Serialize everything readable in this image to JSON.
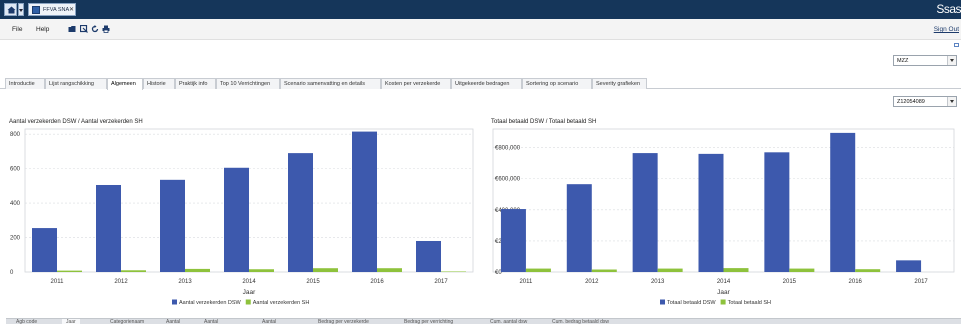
{
  "titlebar": {
    "document_tab_label": "FFVA SNA",
    "document_tab_close": "✕",
    "brand": "Ssas"
  },
  "menubar": {
    "file_label": "File",
    "help_label": "Help",
    "signout_label": "Sign Out"
  },
  "selectors": {
    "region_value": "MZZ",
    "provider_value": "Z12054089"
  },
  "tabs": [
    {
      "label": "Introductie",
      "active": false
    },
    {
      "label": "Lijst rangschikking",
      "active": false
    },
    {
      "label": "Algemeen",
      "active": true
    },
    {
      "label": "Historie",
      "active": false
    },
    {
      "label": "Praktijk info",
      "active": false
    },
    {
      "label": "Top 10 Verrichtingen",
      "active": false
    },
    {
      "label": "Scenario samenvatting en details",
      "active": false
    },
    {
      "label": "Kosten per verzekerde",
      "active": false
    },
    {
      "label": "Uitgekeerde bedragen",
      "active": false
    },
    {
      "label": "Sortering op scenario",
      "active": false
    },
    {
      "label": "Severity grafieken",
      "active": false
    }
  ],
  "colors": {
    "titlebar_bg": "#15365a",
    "series_primary": "#3d59ad",
    "series_secondary": "#8ec23c"
  },
  "chart_data": [
    {
      "type": "bar",
      "title": "Aantal verzekerden DSW / Aantal verzekerden SH",
      "xlabel": "Jaar",
      "ylabel": "",
      "categories": [
        "2011",
        "2012",
        "2013",
        "2014",
        "2015",
        "2016",
        "2017"
      ],
      "series": [
        {
          "name": "Aantal verzekerden DSW",
          "values": [
            255,
            505,
            535,
            605,
            690,
            815,
            180
          ]
        },
        {
          "name": "Aantal verzekerden SH",
          "values": [
            8,
            10,
            18,
            16,
            22,
            22,
            3
          ]
        }
      ],
      "ylim": [
        0,
        830
      ],
      "yticks": [
        0,
        200,
        400,
        600,
        800
      ],
      "ytick_labels": [
        "0",
        "200",
        "400",
        "600",
        "800"
      ],
      "grid": true,
      "legend": "bottom"
    },
    {
      "type": "bar",
      "title": "Totaal betaald DSW / Totaal betaald SH",
      "xlabel": "Jaar",
      "ylabel": "",
      "categories": [
        "2011",
        "2012",
        "2013",
        "2014",
        "2015",
        "2016",
        "2017"
      ],
      "series": [
        {
          "name": "Totaal betaald DSW",
          "values": [
            405000,
            565000,
            765000,
            760000,
            770000,
            895000,
            75000
          ]
        },
        {
          "name": "Totaal betaald SH",
          "values": [
            22000,
            16000,
            22000,
            25000,
            22000,
            18000,
            0
          ]
        }
      ],
      "ylim": [
        0,
        920000
      ],
      "yticks": [
        0,
        200000,
        400000,
        600000,
        800000
      ],
      "ytick_labels": [
        "€0",
        "€200,000",
        "€400,000",
        "€600,000",
        "€800,000"
      ],
      "grid": true,
      "legend": "bottom"
    }
  ],
  "bottom_table": {
    "columns": [
      {
        "label": "Agb code",
        "active": false
      },
      {
        "label": "Jaar",
        "active": true
      },
      {
        "label": "Categorienaam",
        "active": false
      },
      {
        "label": "Aantal",
        "active": false
      },
      {
        "label": "Aantal",
        "active": false
      },
      {
        "label": "Aantal",
        "active": false
      },
      {
        "label": "Bedrag per verzekerde",
        "active": false
      },
      {
        "label": "Bedrag per verrichting",
        "active": false
      },
      {
        "label": "Cum. aantal dsw",
        "active": false
      },
      {
        "label": "Cum. bedrag betaald dsw",
        "active": false
      }
    ]
  }
}
